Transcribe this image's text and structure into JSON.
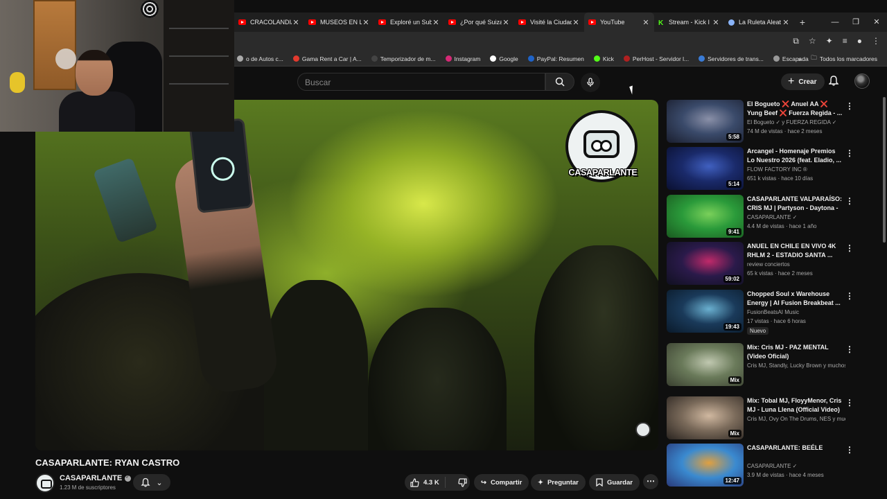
{
  "browser": {
    "tabs": [
      {
        "title": "CRACOLANDIA",
        "icon": "youtube-icon"
      },
      {
        "title": "MUSEOS EN LA",
        "icon": "youtube-icon"
      },
      {
        "title": "Exploré un Sub",
        "icon": "youtube-icon"
      },
      {
        "title": "¿Por qué Suiza",
        "icon": "youtube-icon"
      },
      {
        "title": "Visité la Ciudad",
        "icon": "youtube-icon"
      },
      {
        "title": "YouTube",
        "icon": "youtube-icon",
        "active": true
      },
      {
        "title": "Stream - Kick I",
        "icon": "kick-icon"
      },
      {
        "title": "La Ruleta Aleat",
        "icon": "globe-icon"
      }
    ],
    "bookmarks": [
      {
        "label": "o de Autos c...",
        "color": "#aaaaaa"
      },
      {
        "label": "Gama Rent a Car | A...",
        "color": "#e23a2e"
      },
      {
        "label": "Temporizador de m...",
        "color": "#444444"
      },
      {
        "label": "Instagram",
        "color": "#d62976"
      },
      {
        "label": "Google",
        "color": "#ffffff"
      },
      {
        "label": "PayPal: Resumen",
        "color": "#1f63c7"
      },
      {
        "label": "Kick",
        "color": "#53fc18"
      },
      {
        "label": "PerHost - Servidor l...",
        "color": "#b02020"
      },
      {
        "label": "Servidores de trans...",
        "color": "#3a7bd5"
      },
      {
        "label": "Escapada",
        "color": "#999999"
      }
    ],
    "bookmarks_overflow": "»",
    "all_bookmarks": "Todos los marcadores"
  },
  "youtube": {
    "search_placeholder": "Buscar",
    "create_label": "Crear"
  },
  "video": {
    "overlay_logo_text": "CASAPARLANTE",
    "title": "CASAPARLANTE: RYAN CASTRO",
    "channel": "CASAPARLANTE",
    "subscribers": "1.23 M de suscriptores",
    "likes": "4.3 K",
    "share_label": "Compartir",
    "ask_label": "Preguntar",
    "save_label": "Guardar"
  },
  "recommendations": [
    {
      "title": "El Bogueto ❌ Anuel AA ❌ Yung Beef ❌ Fuerza Regida - ...",
      "channel": "El Bogueto ✓ y FUERZA REGIDA ✓",
      "meta": "74 M de vistas · hace 2 meses",
      "duration": "5:58",
      "badge": "",
      "thumb": [
        "#3a4a6a",
        "#8a90a8",
        "#1a1e2e"
      ]
    },
    {
      "title": "Arcangel - Homenaje Premios Lo Nuestro 2026 (feat. Eladio, ...",
      "channel": "FLOW FACTORY INC ®",
      "meta": "651 k vistas · hace 10 días",
      "duration": "5:14",
      "badge": "",
      "thumb": [
        "#1a2a6a",
        "#4060c0",
        "#0a1030"
      ]
    },
    {
      "title": "CASAPARLANTE VALPARAÍSO: CRIS MJ | Partyson - Daytona - ...",
      "channel": "CASAPARLANTE ✓",
      "meta": "4.4 M de vistas · hace 1 año",
      "duration": "9:41",
      "badge": "",
      "thumb": [
        "#2a9a3a",
        "#7ad05a",
        "#1a5a20"
      ]
    },
    {
      "title": "ANUEL EN CHILE EN VIVO 4K RHLM 2 - ESTADIO SANTA ...",
      "channel": "review conciertos",
      "meta": "65 k vistas · hace 2 meses",
      "duration": "59:02",
      "badge": "",
      "thumb": [
        "#2a1a4a",
        "#c02a6a",
        "#101020"
      ]
    },
    {
      "title": "Chopped Soul x Warehouse Energy | AI Fusion Breakbeat ...",
      "channel": "FusionBeatsAI Music",
      "meta": "17 vistas · hace 6 horas",
      "duration": "19:43",
      "badge": "Nuevo",
      "thumb": [
        "#1a3a5a",
        "#6ab0d0",
        "#0a1a2a"
      ]
    },
    {
      "title": "Mix: Cris MJ - PAZ MENTAL (Video Oficial)",
      "channel": "Cris MJ, Standly, Lucky Brown y muchos ...",
      "meta": "",
      "duration": "Mix",
      "badge": "",
      "thumb": [
        "#6a7a5a",
        "#c0c8b0",
        "#3a4030"
      ]
    },
    {
      "title": "Mix: Tobal MJ, FloyyMenor, Cris MJ - Luna Llena (Official Video)",
      "channel": "Cris MJ, Ovy On The Drums, NES y much...",
      "meta": "",
      "duration": "Mix",
      "badge": "",
      "thumb": [
        "#7a6a5a",
        "#d0b8a0",
        "#2a2420"
      ]
    },
    {
      "title": "CASAPARLANTE: BEÉLE",
      "channel": "CASAPARLANTE ✓",
      "meta": "3.9 M de vistas · hace 4 meses",
      "duration": "12:47",
      "badge": "",
      "thumb": [
        "#3a8ad0",
        "#e0a040",
        "#2a3a7a"
      ]
    }
  ]
}
